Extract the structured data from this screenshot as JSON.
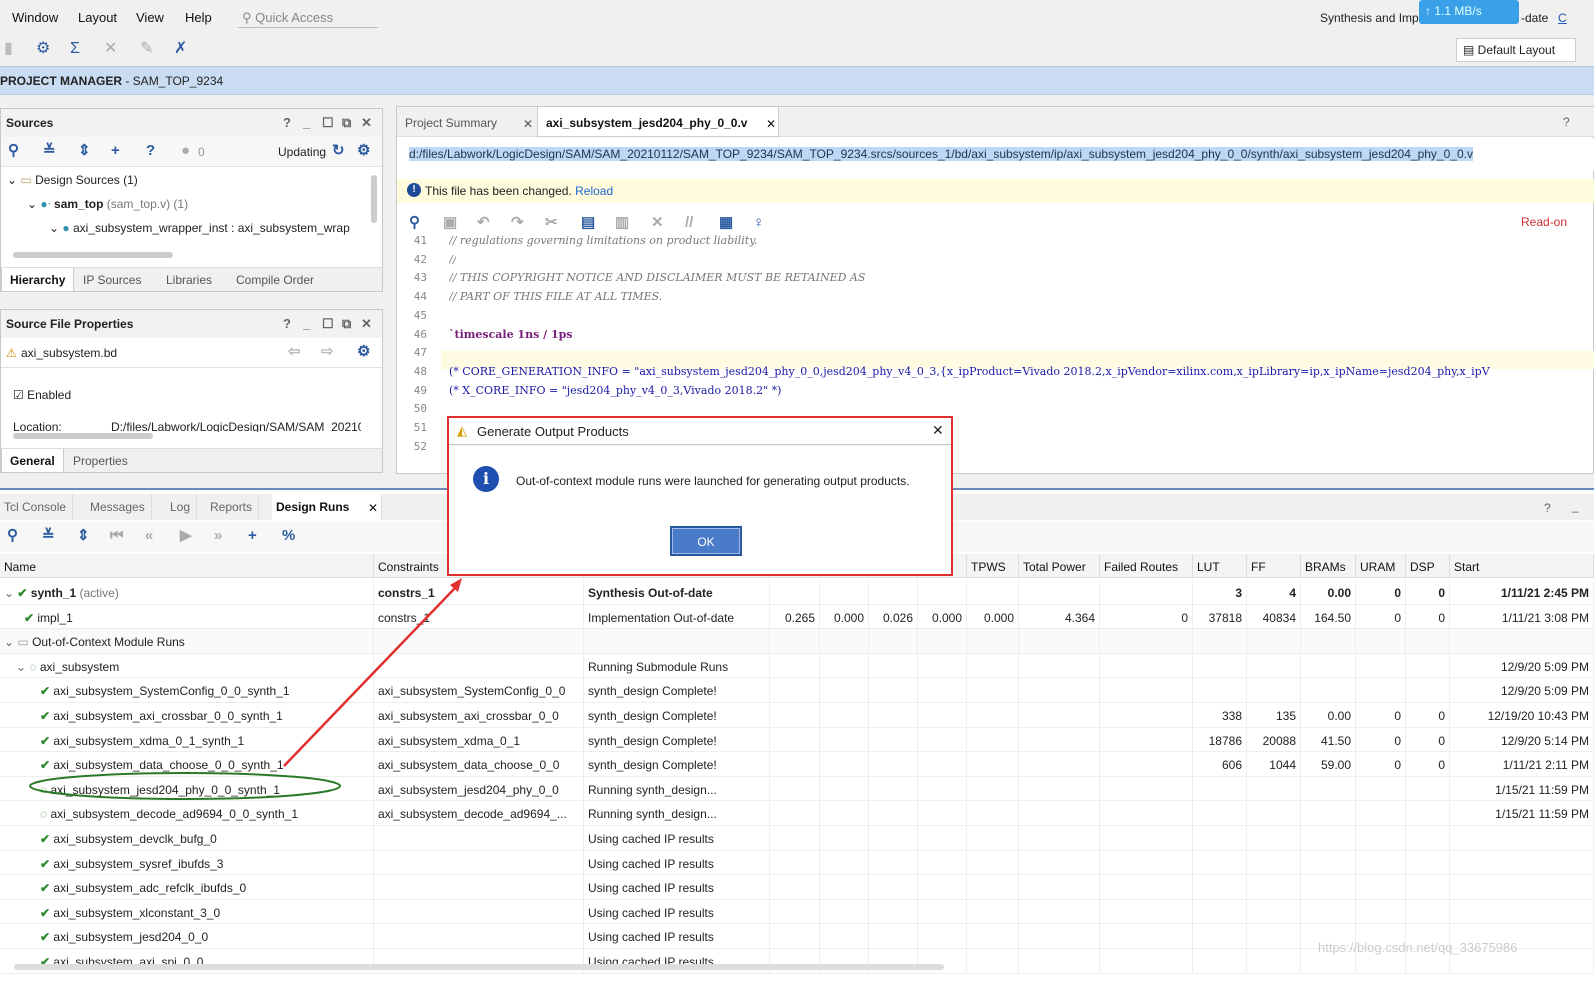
{
  "menu": {
    "window": "Window",
    "layout": "Layout",
    "view": "View",
    "help": "Help",
    "quick_access": "Quick Access"
  },
  "status": {
    "synth_impl": "Synthesis and Imp",
    "uptodate": "-date",
    "net_speed": "1.1 MB/s",
    "default_layout": "Default Layout",
    "link_c": "C"
  },
  "project": {
    "label": "PROJECT MANAGER",
    "name": " - SAM_TOP_9234"
  },
  "sources": {
    "title": "Sources",
    "count": "0",
    "updating": "Updating",
    "design_sources": "Design Sources (1)",
    "top": "sam_top",
    "top_file": "(sam_top.v) (1)",
    "wrapper": "axi_subsystem_wrapper_inst : axi_subsystem_wrap",
    "tabs": [
      "Hierarchy",
      "IP Sources",
      "Libraries",
      "Compile Order"
    ]
  },
  "sfp": {
    "title": "Source File Properties",
    "file": "axi_subsystem.bd",
    "enabled": "Enabled",
    "location_label": "Location:",
    "location_value": "D:/files/Labwork/LogicDesign/SAM/SAM_20210",
    "tabs": [
      "General",
      "Properties"
    ]
  },
  "editor": {
    "tabs": [
      "Project Summary",
      "axi_subsystem_jesd204_phy_0_0.v"
    ],
    "path": "d:/files/Labwork/LogicDesign/SAM/SAM_20210112/SAM_TOP_9234/SAM_TOP_9234.srcs/sources_1/bd/axi_subsystem/ip/axi_subsystem_jesd204_phy_0_0/synth/axi_subsystem_jesd204_phy_0_0.v",
    "changed": "This file has been changed.",
    "reload": "Reload",
    "readonly": "Read-on",
    "lines": [
      {
        "n": "41",
        "t": "// regulations governing limitations on product liability."
      },
      {
        "n": "42",
        "t": "//"
      },
      {
        "n": "43",
        "t": "// THIS COPYRIGHT NOTICE AND DISCLAIMER MUST BE RETAINED AS"
      },
      {
        "n": "44",
        "t": "// PART OF THIS FILE AT ALL TIMES."
      },
      {
        "n": "45",
        "t": ""
      },
      {
        "n": "46",
        "t": "`timescale 1ns / 1ps"
      },
      {
        "n": "47",
        "t": ""
      },
      {
        "n": "48",
        "t": "(* CORE_GENERATION_INFO = \"axi_subsystem_jesd204_phy_0_0,jesd204_phy_v4_0_3,{x_ipProduct=Vivado 2018.2,x_ipVendor=xilinx.com,x_ipLibrary=ip,x_ipName=jesd204_phy,x_ipV"
      },
      {
        "n": "49",
        "t": "(* X_CORE_INFO = \"jesd204_phy_v4_0_3,Vivado 2018.2\" *)"
      },
      {
        "n": "50",
        "t": ""
      },
      {
        "n": "51",
        "t": ""
      },
      {
        "n": "52",
        "t": ""
      }
    ]
  },
  "bottom": {
    "tabs": [
      "Tcl Console",
      "Messages",
      "Log",
      "Reports",
      "Design Runs"
    ],
    "headers": [
      "Name",
      "Constraints",
      "",
      "",
      "",
      "",
      "",
      "TPWS",
      "Total Power",
      "Failed Routes",
      "LUT",
      "FF",
      "BRAMs",
      "URAM",
      "DSP",
      "Start"
    ],
    "rows": [
      {
        "name": "synth_1",
        "extra": " (active)",
        "cons": "constrs_1",
        "status": "Synthesis Out-of-date",
        "c4": "",
        "c5": "",
        "c6": "",
        "c7": "",
        "tpws": "",
        "power": "",
        "failed": "",
        "lut": "3",
        "ff": "4",
        "brams": "0.00",
        "uram": "0",
        "dsp": "0",
        "start": "1/11/21 2:45 PM"
      },
      {
        "name": "impl_1",
        "extra": "",
        "cons": "constrs_1",
        "status": "Implementation Out-of-date",
        "c4": "0.265",
        "c5": "0.000",
        "c6": "0.026",
        "c7": "0.000",
        "tpws": "0.000",
        "power": "4.364",
        "failed": "0",
        "lut": "37818",
        "ff": "40834",
        "brams": "164.50",
        "uram": "0",
        "dsp": "0",
        "start": "1/11/21 3:08 PM"
      },
      {
        "name": "Out-of-Context Module Runs",
        "extra": "",
        "cons": "",
        "status": "",
        "c4": "",
        "c5": "",
        "c6": "",
        "c7": "",
        "tpws": "",
        "power": "",
        "failed": "",
        "lut": "",
        "ff": "",
        "brams": "",
        "uram": "",
        "dsp": "",
        "start": ""
      },
      {
        "name": "axi_subsystem",
        "extra": "",
        "cons": "",
        "status": "Running Submodule Runs",
        "c4": "",
        "c5": "",
        "c6": "",
        "c7": "",
        "tpws": "",
        "power": "",
        "failed": "",
        "lut": "",
        "ff": "",
        "brams": "",
        "uram": "",
        "dsp": "",
        "start": "12/9/20 5:09 PM"
      },
      {
        "name": "axi_subsystem_SystemConfig_0_0_synth_1",
        "extra": "",
        "cons": "axi_subsystem_SystemConfig_0_0",
        "status": "synth_design Complete!",
        "c4": "",
        "c5": "",
        "c6": "",
        "c7": "",
        "tpws": "",
        "power": "",
        "failed": "",
        "lut": "",
        "ff": "",
        "brams": "",
        "uram": "",
        "dsp": "",
        "start": "12/9/20 5:09 PM"
      },
      {
        "name": "axi_subsystem_axi_crossbar_0_0_synth_1",
        "extra": "",
        "cons": "axi_subsystem_axi_crossbar_0_0",
        "status": "synth_design Complete!",
        "c4": "",
        "c5": "",
        "c6": "",
        "c7": "",
        "tpws": "",
        "power": "",
        "failed": "",
        "lut": "338",
        "ff": "135",
        "brams": "0.00",
        "uram": "0",
        "dsp": "0",
        "start": "12/19/20 10:43 PM"
      },
      {
        "name": "axi_subsystem_xdma_0_1_synth_1",
        "extra": "",
        "cons": "axi_subsystem_xdma_0_1",
        "status": "synth_design Complete!",
        "c4": "",
        "c5": "",
        "c6": "",
        "c7": "",
        "tpws": "",
        "power": "",
        "failed": "",
        "lut": "18786",
        "ff": "20088",
        "brams": "41.50",
        "uram": "0",
        "dsp": "0",
        "start": "12/9/20 5:14 PM"
      },
      {
        "name": "axi_subsystem_data_choose_0_0_synth_1",
        "extra": "",
        "cons": "axi_subsystem_data_choose_0_0",
        "status": "synth_design Complete!",
        "c4": "",
        "c5": "",
        "c6": "",
        "c7": "",
        "tpws": "",
        "power": "",
        "failed": "",
        "lut": "606",
        "ff": "1044",
        "brams": "59.00",
        "uram": "0",
        "dsp": "0",
        "start": "1/11/21 2:11 PM"
      },
      {
        "name": "axi_subsystem_jesd204_phy_0_0_synth_1",
        "extra": "",
        "cons": "axi_subsystem_jesd204_phy_0_0",
        "status": "Running synth_design...",
        "c4": "",
        "c5": "",
        "c6": "",
        "c7": "",
        "tpws": "",
        "power": "",
        "failed": "",
        "lut": "",
        "ff": "",
        "brams": "",
        "uram": "",
        "dsp": "",
        "start": "1/15/21 11:59 PM"
      },
      {
        "name": "axi_subsystem_decode_ad9694_0_0_synth_1",
        "extra": "",
        "cons": "axi_subsystem_decode_ad9694_...",
        "status": "Running synth_design...",
        "c4": "",
        "c5": "",
        "c6": "",
        "c7": "",
        "tpws": "",
        "power": "",
        "failed": "",
        "lut": "",
        "ff": "",
        "brams": "",
        "uram": "",
        "dsp": "",
        "start": "1/15/21 11:59 PM"
      },
      {
        "name": "axi_subsystem_devclk_bufg_0",
        "extra": "",
        "cons": "",
        "status": "Using cached IP results",
        "c4": "",
        "c5": "",
        "c6": "",
        "c7": "",
        "tpws": "",
        "power": "",
        "failed": "",
        "lut": "",
        "ff": "",
        "brams": "",
        "uram": "",
        "dsp": "",
        "start": ""
      },
      {
        "name": "axi_subsystem_sysref_ibufds_3",
        "extra": "",
        "cons": "",
        "status": "Using cached IP results",
        "c4": "",
        "c5": "",
        "c6": "",
        "c7": "",
        "tpws": "",
        "power": "",
        "failed": "",
        "lut": "",
        "ff": "",
        "brams": "",
        "uram": "",
        "dsp": "",
        "start": ""
      },
      {
        "name": "axi_subsystem_adc_refclk_ibufds_0",
        "extra": "",
        "cons": "",
        "status": "Using cached IP results",
        "c4": "",
        "c5": "",
        "c6": "",
        "c7": "",
        "tpws": "",
        "power": "",
        "failed": "",
        "lut": "",
        "ff": "",
        "brams": "",
        "uram": "",
        "dsp": "",
        "start": ""
      },
      {
        "name": "axi_subsystem_xlconstant_3_0",
        "extra": "",
        "cons": "",
        "status": "Using cached IP results",
        "c4": "",
        "c5": "",
        "c6": "",
        "c7": "",
        "tpws": "",
        "power": "",
        "failed": "",
        "lut": "",
        "ff": "",
        "brams": "",
        "uram": "",
        "dsp": "",
        "start": ""
      },
      {
        "name": "axi_subsystem_jesd204_0_0",
        "extra": "",
        "cons": "",
        "status": "Using cached IP results",
        "c4": "",
        "c5": "",
        "c6": "",
        "c7": "",
        "tpws": "",
        "power": "",
        "failed": "",
        "lut": "",
        "ff": "",
        "brams": "",
        "uram": "",
        "dsp": "",
        "start": ""
      },
      {
        "name": "axi_subsystem_axi_spi_0_0",
        "extra": "",
        "cons": "",
        "status": "Using cached IP results",
        "c4": "",
        "c5": "",
        "c6": "",
        "c7": "",
        "tpws": "",
        "power": "",
        "failed": "",
        "lut": "",
        "ff": "",
        "brams": "",
        "uram": "",
        "dsp": "",
        "start": ""
      }
    ]
  },
  "dialog": {
    "title": "Generate Output Products",
    "message": "Out-of-context module runs were launched for generating output products.",
    "ok": "OK"
  },
  "watermark": "https://blog.csdn.net/qq_33675986",
  "colors": {
    "highlight_box": "#e03030",
    "annotation_ellipse": "#2a7a2a",
    "accent": "#4a7bc8"
  }
}
